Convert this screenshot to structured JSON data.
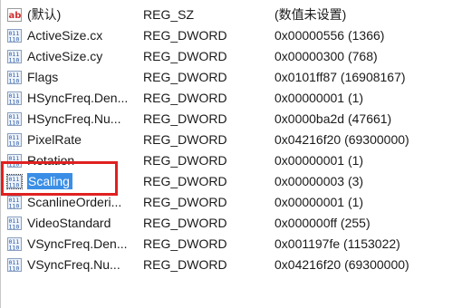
{
  "registry_values": [
    {
      "icon": "string-value-icon",
      "name": "(默认)",
      "type": "REG_SZ",
      "data": "(数值未设置)"
    },
    {
      "icon": "binary-value-icon",
      "name": "ActiveSize.cx",
      "type": "REG_DWORD",
      "data": "0x00000556 (1366)"
    },
    {
      "icon": "binary-value-icon",
      "name": "ActiveSize.cy",
      "type": "REG_DWORD",
      "data": "0x00000300 (768)"
    },
    {
      "icon": "binary-value-icon",
      "name": "Flags",
      "type": "REG_DWORD",
      "data": "0x0101ff87 (16908167)"
    },
    {
      "icon": "binary-value-icon",
      "name": "HSyncFreq.Den...",
      "type": "REG_DWORD",
      "data": "0x00000001 (1)"
    },
    {
      "icon": "binary-value-icon",
      "name": "HSyncFreq.Nu...",
      "type": "REG_DWORD",
      "data": "0x0000ba2d (47661)"
    },
    {
      "icon": "binary-value-icon",
      "name": "PixelRate",
      "type": "REG_DWORD",
      "data": "0x04216f20 (69300000)"
    },
    {
      "icon": "binary-value-icon",
      "name": "Rotation",
      "type": "REG_DWORD",
      "data": "0x00000001 (1)"
    },
    {
      "icon": "binary-value-icon",
      "name": "Scaling",
      "type": "REG_DWORD",
      "data": "0x00000003 (3)",
      "selected": true
    },
    {
      "icon": "binary-value-icon",
      "name": "ScanlineOrderi...",
      "type": "REG_DWORD",
      "data": "0x00000001 (1)"
    },
    {
      "icon": "binary-value-icon",
      "name": "VideoStandard",
      "type": "REG_DWORD",
      "data": "0x000000ff (255)"
    },
    {
      "icon": "binary-value-icon",
      "name": "VSyncFreq.Den...",
      "type": "REG_DWORD",
      "data": "0x001197fe (1153022)"
    },
    {
      "icon": "binary-value-icon",
      "name": "VSyncFreq.Nu...",
      "type": "REG_DWORD",
      "data": "0x04216f20 (69300000)"
    }
  ],
  "colors": {
    "selection": "#3a8ee6",
    "highlight_box": "#e02020"
  }
}
